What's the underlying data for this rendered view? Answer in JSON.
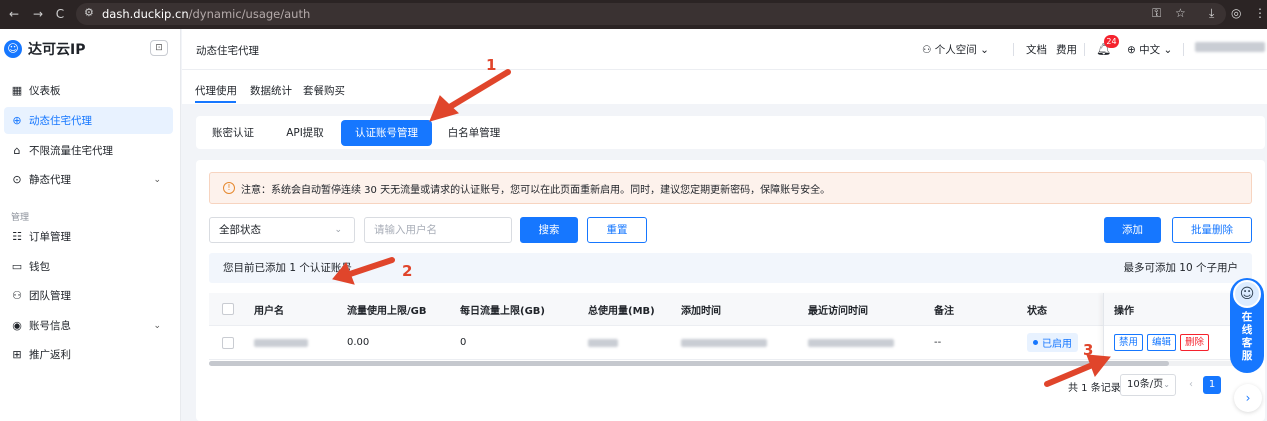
{
  "browser": {
    "url_host": "dash.duckip.cn",
    "url_path": "/dynamic/usage/auth",
    "back_icon": "←",
    "forward_icon": "→",
    "reload_icon": "C"
  },
  "brand": {
    "name": "达可云IP"
  },
  "sidebar": {
    "items": [
      {
        "label": "仪表板",
        "icon": "dashboard-icon"
      },
      {
        "label": "动态住宅代理",
        "icon": "globe-icon"
      },
      {
        "label": "不限流量住宅代理",
        "icon": "home-icon"
      },
      {
        "label": "静态代理",
        "icon": "target-icon"
      }
    ],
    "group_label": "管理",
    "manage_items": [
      {
        "label": "订单管理",
        "icon": "order-icon"
      },
      {
        "label": "钱包",
        "icon": "wallet-icon"
      },
      {
        "label": "团队管理",
        "icon": "team-icon"
      },
      {
        "label": "账号信息",
        "icon": "account-icon"
      },
      {
        "label": "推广返利",
        "icon": "gift-icon"
      }
    ]
  },
  "header": {
    "title": "动态住宅代理",
    "workspace": "个人空间",
    "docs": "文档",
    "pricing": "费用",
    "notifications": "24",
    "language": "中文"
  },
  "tabs": {
    "items": [
      "代理使用",
      "数据统计",
      "套餐购买"
    ]
  },
  "segments": {
    "items": [
      "账密认证",
      "API提取",
      "认证账号管理",
      "白名单管理"
    ]
  },
  "notice": {
    "text": "注意：系统会自动暂停连续 30 天无流量或请求的认证账号，您可以在此页面重新启用。同时，建议您定期更新密码，保障账号安全。"
  },
  "filters": {
    "status_select": "全部状态",
    "username_placeholder": "请输入用户名",
    "search": "搜索",
    "reset": "重置",
    "add": "添加",
    "bulk_delete": "批量删除"
  },
  "info": {
    "left": "您目前已添加 1 个认证账号",
    "right": "最多可添加 10 个子用户"
  },
  "table": {
    "headers": [
      "用户名",
      "流量使用上限/GB",
      "每日流量上限(GB)",
      "总使用量(MB)",
      "添加时间",
      "最近访问时间",
      "备注",
      "状态",
      "操作"
    ],
    "rows": [
      {
        "traffic_limit": "0.00",
        "daily_limit": "0",
        "remark": "--",
        "status": "已启用",
        "actions": [
          "禁用",
          "编辑",
          "删除"
        ]
      }
    ]
  },
  "pagination": {
    "total": "共 1 条记录",
    "page_size": "10条/页",
    "current": "1"
  },
  "annotations": [
    "1",
    "2",
    "3"
  ],
  "float": {
    "service_label": "在线客服",
    "service_lines": [
      "在",
      "线",
      "客",
      "服"
    ]
  },
  "colors": {
    "accent": "#1677ff",
    "annotation": "#e0452b",
    "danger": "#f5222d"
  }
}
